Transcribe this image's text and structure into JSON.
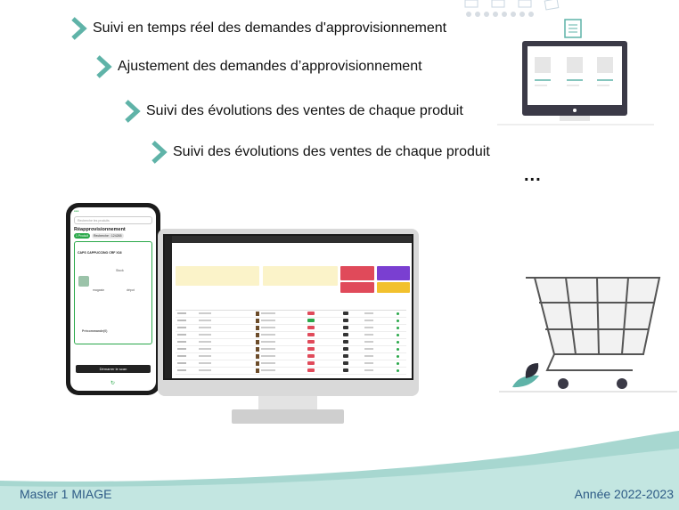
{
  "bullets": [
    {
      "text": "Suivi en temps réel des demandes d'approvisionnement"
    },
    {
      "text": "Ajustement des demandes d’approvisionnement"
    },
    {
      "text": "Suivi des évolutions des ventes de chaque produit"
    },
    {
      "text": "Suivi des évolutions des ventes de chaque produit"
    }
  ],
  "ellipsis": "...",
  "phone": {
    "search_placeholder": "Recherche les produits",
    "title": "Réapprovisionnement",
    "chip_produit": "1 Produit",
    "chip_recherche": "Recherche : 124265",
    "product_name": "CAPS CAPPUCCINO CRF X16",
    "stock_label": "Stock",
    "magasin_label": "magasin",
    "depot_label": "dépot",
    "preco_label": "Précommande(0)",
    "scan_button": "Démarrer le scan"
  },
  "footer": {
    "left": "Master 1 MIAGE",
    "right": "Année 2022-2023"
  },
  "colors": {
    "accent_teal": "#5fb3a8",
    "footer_text": "#2e5b86",
    "wave": "#a7d7d0",
    "phone_green": "#2aa84a"
  }
}
